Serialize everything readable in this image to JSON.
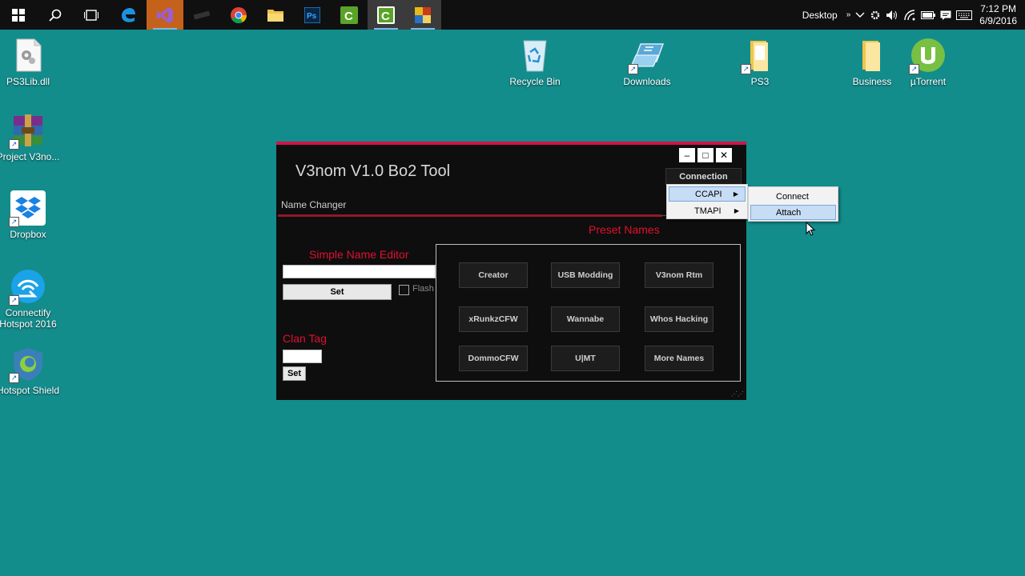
{
  "taskbar": {
    "apps": [
      "start-icon",
      "search-icon",
      "task-view-icon",
      "edge-icon",
      "visual-studio-icon",
      "app-icon",
      "chrome-icon",
      "file-explorer-icon",
      "photoshop-icon",
      "camtasia-icon",
      "camtasia-recorder-icon",
      "app-tile-icon"
    ],
    "tray": {
      "desktop_label": "Desktop",
      "time": "7:12 PM",
      "date": "6/9/2016"
    }
  },
  "desktop_icons": [
    {
      "label": "PS3Lib.dll",
      "icon": "dll-file-icon"
    },
    {
      "label": "Project V3no...",
      "icon": "winrar-archive-icon"
    },
    {
      "label": "Dropbox",
      "icon": "dropbox-icon"
    },
    {
      "label": "Connectify Hotspot 2016",
      "icon": "connectify-icon"
    },
    {
      "label": "Hotspot Shield",
      "icon": "hotspot-shield-icon"
    },
    {
      "label": "Recycle Bin",
      "icon": "recycle-bin-icon"
    },
    {
      "label": "Downloads",
      "icon": "downloads-folder-icon"
    },
    {
      "label": "PS3",
      "icon": "folder-icon"
    },
    {
      "label": "Business",
      "icon": "folder-icon"
    },
    {
      "label": "µTorrent",
      "icon": "utorrent-icon"
    }
  ],
  "app": {
    "title": "V3nom V1.0 Bo2 Tool",
    "controls": {
      "minimize": "–",
      "maximize": "□",
      "close": "✕"
    },
    "connection_button": "Connection",
    "tab": "Name Changer",
    "simple_name_editor": {
      "heading": "Simple Name Editor",
      "value": "",
      "set_button": "Set",
      "flash_label": "Flash",
      "flash_checked": false
    },
    "clan_tag": {
      "heading": "Clan Tag",
      "value": "",
      "set_button": "Set"
    },
    "preset_names": {
      "heading": "Preset Names",
      "buttons": [
        "Creator",
        "USB Modding",
        "V3nom Rtm",
        "xRunkzCFW",
        "Wannabe",
        "Whos Hacking",
        "DommoCFW",
        "U|MT",
        "More Names"
      ]
    }
  },
  "connection_menu": {
    "items": [
      {
        "label": "CCAPI",
        "highlighted": true
      },
      {
        "label": "TMAPI",
        "highlighted": false
      }
    ],
    "submenu": {
      "items": [
        {
          "label": "Connect",
          "highlighted": false
        },
        {
          "label": "Attach",
          "highlighted": true
        }
      ]
    }
  },
  "colors": {
    "desktop": "#138c8c",
    "accent": "#d0144a",
    "red_text": "#e0102f",
    "menu_highlight": "#c7ddf5"
  }
}
